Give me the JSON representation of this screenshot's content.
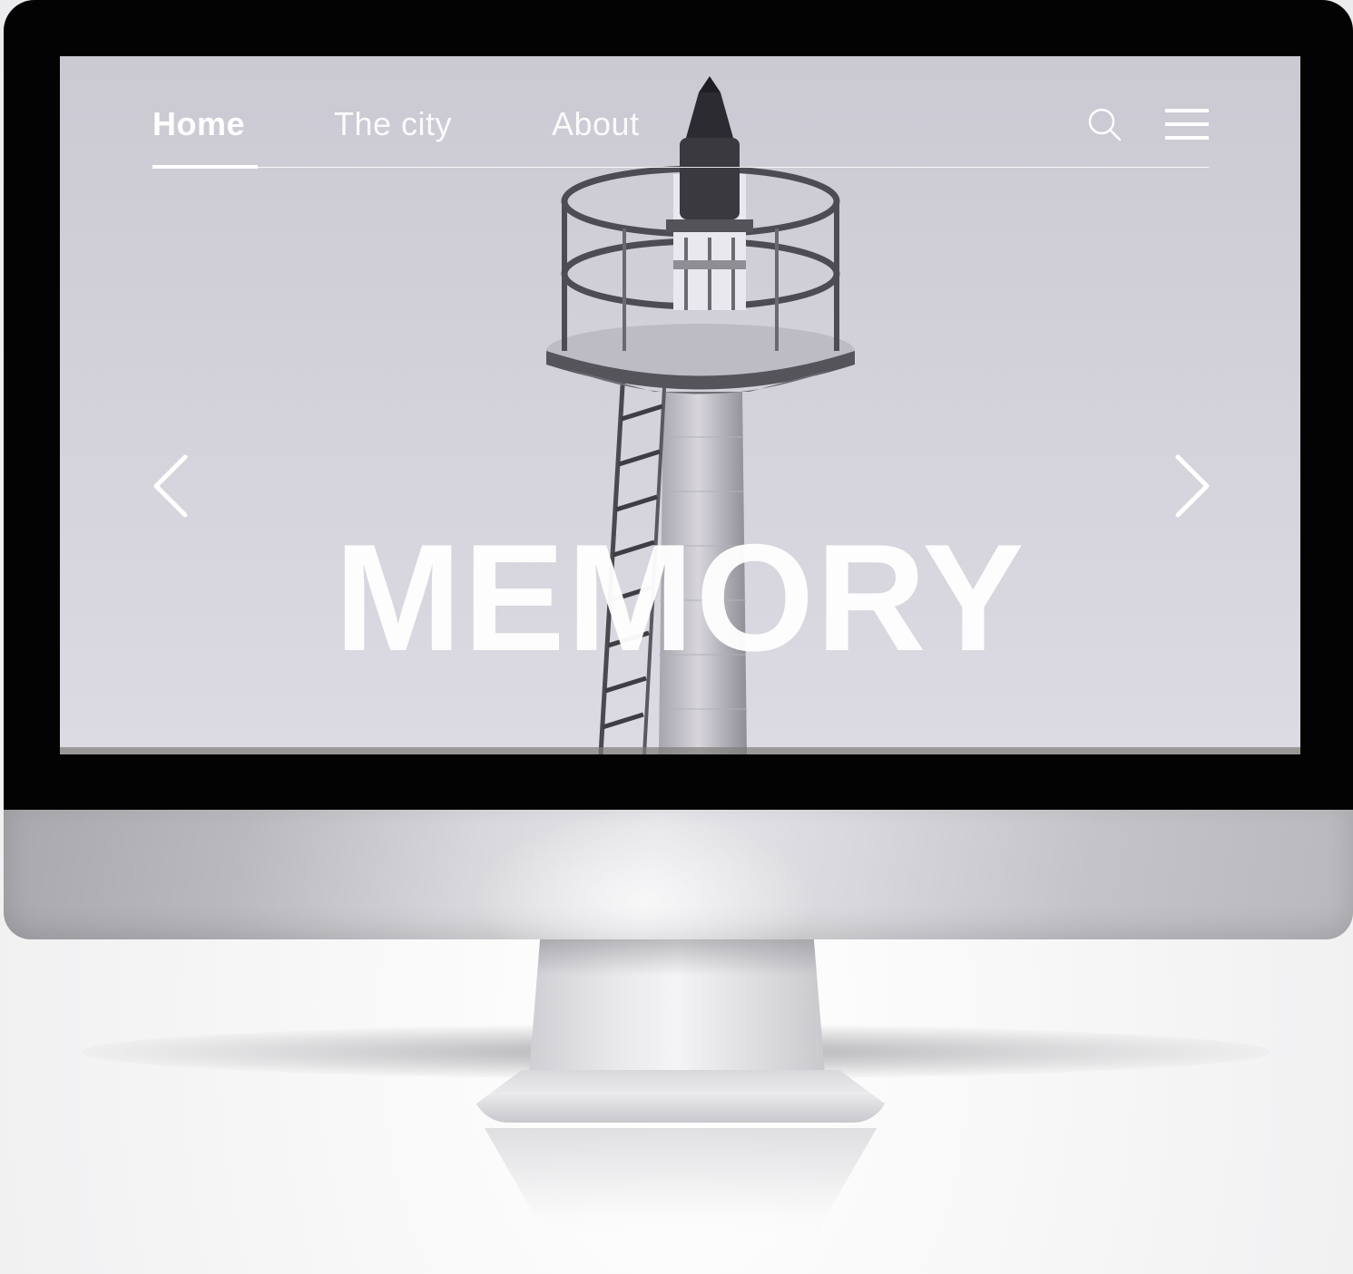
{
  "nav": {
    "items": [
      {
        "label": "Home",
        "active": true
      },
      {
        "label": "The city",
        "active": false
      },
      {
        "label": "About",
        "active": false
      }
    ],
    "search_icon": "search-icon",
    "menu_icon": "hamburger-menu-icon"
  },
  "hero": {
    "title": "MEMORY",
    "prev_icon": "chevron-left-icon",
    "next_icon": "chevron-right-icon",
    "image": "lighthouse-photo"
  },
  "colors": {
    "nav_text": "#ffffff",
    "bezel": "#030303",
    "screen_tint": "#d6d4dd"
  }
}
